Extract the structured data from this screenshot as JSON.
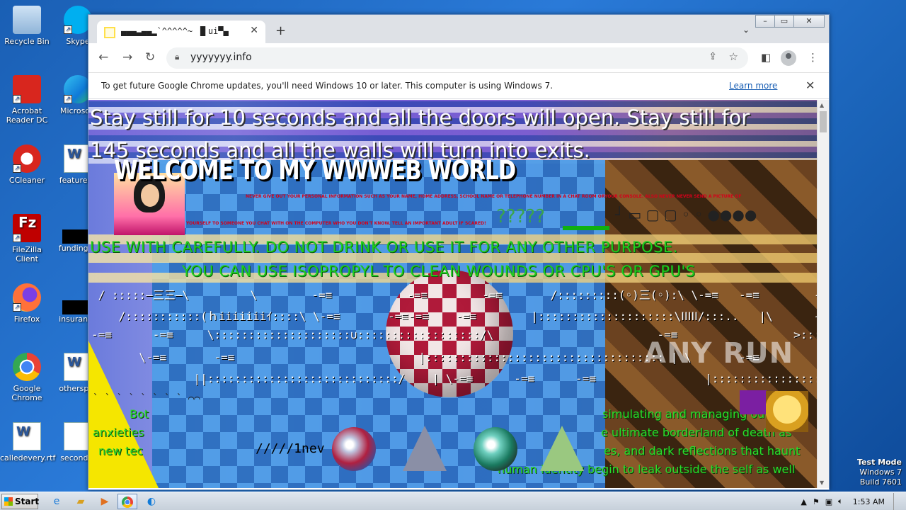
{
  "desktop": {
    "icons": [
      {
        "label": "Recycle Bin"
      },
      {
        "label": "Skype"
      },
      {
        "label": "Acrobat Reader DC"
      },
      {
        "label": "Microsoft"
      },
      {
        "label": "CCleaner"
      },
      {
        "label": "featureds"
      },
      {
        "label": "FileZilla Client"
      },
      {
        "label": "fundingse"
      },
      {
        "label": "Firefox"
      },
      {
        "label": "insurance"
      },
      {
        "label": "Google Chrome"
      },
      {
        "label": "otherspor"
      },
      {
        "label": "calledevery.rtf"
      },
      {
        "label": "secondtc"
      }
    ],
    "test_mode": {
      "line1": "Test Mode",
      "line2": "Windows 7",
      "line3": "Build 7601"
    }
  },
  "browser": {
    "tab_title": "▄▄▄▃▄▄▂`^^^^^~ ▐▌ui▀▄",
    "new_tab": "+",
    "url": "yyyyyyy.info",
    "infobar": {
      "message": "To get future Google Chrome updates, you'll need Windows 10 or later. This computer is using Windows 7.",
      "link": "Learn more"
    }
  },
  "webpage": {
    "intro_line1": "Stay still for 10 seconds and all the doors will open. Stay still for",
    "intro_line2": "145 seconds and all the walls will turn into exits.",
    "welcome": "WELCOME TO MY WWWEB WORLD",
    "red_line1": "NEVER GIVE OUT YOUR PERSONAL INFORMATION SUCH AS YOUR NAME, HOME ADDRESS, SCHOOL NAME OR TELEPHONE NUMBER IN A CHAT ROOM ORYOUR CONSOLE. ALSO NEVER NEVER SEND A PICTURE OF",
    "red_line2": "YOURSELF TO SOMEONE YOU CHAT WITH ON THE COMPUTER WHO YOU DON'T KNOW. TELL AN IMPORTANT ADULT IF SCARED!",
    "question_marks": "?????",
    "symbols_row": "┘  ▭ ▢ ▢ ◦ ◦ ●●●●",
    "warning1": "USE WITH CAREFULLY. DO NOT DRINK OR USE IT FOR ANY OTHER PURPOSE.",
    "warning2": "YOU CAN USE ISOPROPYL TO CLEAN WOUNDS OR CPU'S OR GPU'S",
    "ascii1": " / :::::—三三—\\         \\        -=≡           -=≡        -=≡       /:::::::::(◦)三(◦):\\ \\-=≡   -=≡        -=≡",
    "ascii2": "    /:::::::::::(ｈiiiiiiiｲ::::\\ \\-=≡       -=≡-=≡    -=≡        |::::::::::::::::::::\\ⅠⅠⅠⅠⅠ/:::..   |\\      -=≡         -",
    "ascii3": "-=≡      -=≡     \\::::::::::::::::::::∪::::::::::::::::::/\\                        -=≡                 >::::::::::::::::::::::::::::::::<",
    "ascii4": "       \\-=≡       -=≡                           |::::::::::::::::::::::::::::::::::: | \\       -=≡         -=≡        -=≡",
    "ascii5": "               ||::::::::::::::::::::::::::::/    | \\-=≡      -=≡      -=≡                |::::::::::::::::::::::::::/ | |",
    "green_para_left1": "Bot",
    "green_para_left2": "anxieties",
    "green_para_left3": "new tec",
    "green_para_right1": "simulating and managing our ine",
    "green_para_right2": "e ultimate borderland of death as",
    "green_para_right3": "es, and dark reflections that haunt",
    "green_para_right4": "human identity begin to leak outside the self as well",
    "scribble": "/////1nev",
    "glyph_row": "` ` ` ` ` ` ` ` ⌒⌒"
  },
  "taskbar": {
    "start_label": "Start",
    "clock": "1:53 AM"
  },
  "watermark": "ANY RUN"
}
